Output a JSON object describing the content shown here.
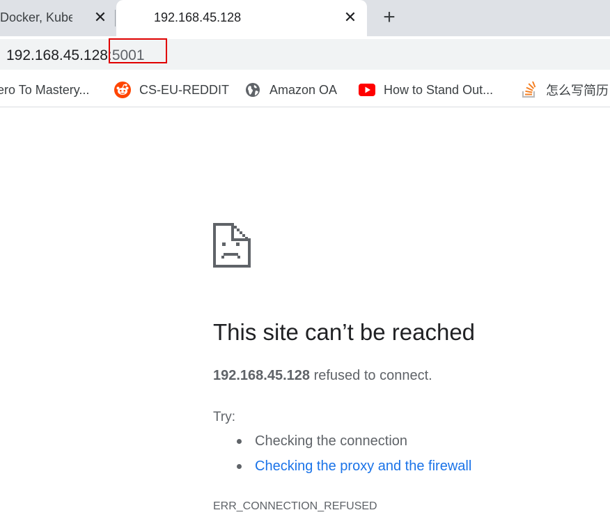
{
  "tabs": [
    {
      "title": "Docker, Kuberne",
      "close_glyph": "✕"
    },
    {
      "title": "192.168.45.128",
      "close_glyph": "✕"
    }
  ],
  "new_tab_glyph": "+",
  "address_bar": {
    "host": "192.168.45.128",
    "port": ":5001"
  },
  "bookmarks": [
    {
      "label": "ero To Mastery...",
      "icon": "none"
    },
    {
      "label": "CS-EU-REDDIT",
      "icon": "reddit-icon",
      "color": "#ff4500"
    },
    {
      "label": "Amazon OA",
      "icon": "globe-icon",
      "color": "#5f6368"
    },
    {
      "label": "How to Stand Out...",
      "icon": "youtube-icon",
      "color": "#ff0000"
    },
    {
      "label": "怎么写简历",
      "icon": "stackoverflow-icon",
      "color": "#f48024"
    }
  ],
  "error": {
    "icon": "sad-page-icon",
    "title": "This site can’t be reached",
    "host": "192.168.45.128",
    "message": " refused to connect.",
    "try_label": "Try:",
    "suggestions": [
      "Checking the connection",
      "Checking the proxy and the firewall"
    ],
    "code": "ERR_CONNECTION_REFUSED"
  },
  "colors": {
    "link": "#1a73e8",
    "highlight_box": "#e00000",
    "tabstrip": "#dee1e6"
  }
}
